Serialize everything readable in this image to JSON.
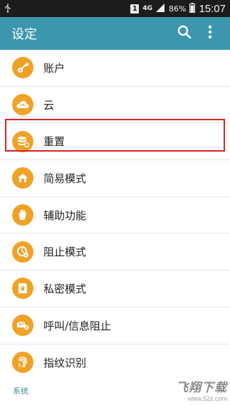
{
  "status_bar": {
    "sim_slot": "1",
    "network": "4G",
    "battery": "86%",
    "time": "15:07"
  },
  "app_bar": {
    "title": "设定",
    "actions": [
      "search-icon",
      "more-vert-icon"
    ]
  },
  "settings": [
    {
      "label": "账户",
      "icon": "key-icon"
    },
    {
      "label": "云",
      "icon": "cloud-icon"
    },
    {
      "label": "重置",
      "icon": "reset-icon",
      "highlighted": true
    },
    {
      "label": "简易模式",
      "icon": "easy-mode-icon"
    },
    {
      "label": "辅助功能",
      "icon": "hand-icon"
    },
    {
      "label": "阻止模式",
      "icon": "block-icon"
    },
    {
      "label": "私密模式",
      "icon": "private-icon"
    },
    {
      "label": "呼叫/信息阻止",
      "icon": "call-block-icon"
    },
    {
      "label": "指纹识别",
      "icon": "fingerprint-icon"
    }
  ],
  "section_header": "系统",
  "watermark": {
    "title": "飞翔下载",
    "url": "www.52z.com"
  },
  "colors": {
    "app_bar": "#3c96ae",
    "icon_bg": "#f0a227",
    "highlight": "#d42424",
    "section_header": "#3a8fa6"
  }
}
